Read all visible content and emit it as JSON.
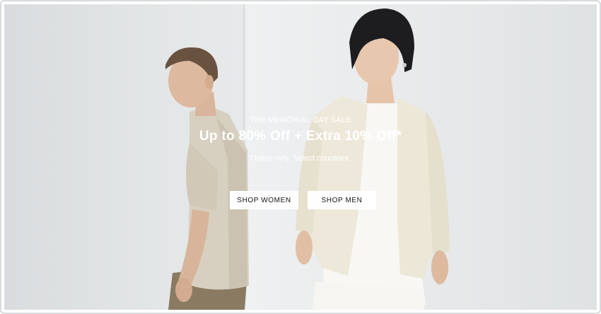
{
  "hero": {
    "kicker": "THE MEMORIAL DAY SALE",
    "headline": "Up to 80% Off + Extra 10% Off*",
    "subline": "Online only. Select countries."
  },
  "actions": {
    "shop_women_label": "SHOP WOMEN",
    "shop_men_label": "SHOP MEN"
  },
  "colors": {
    "wall": "#e8eaeb",
    "text": "#ffffff",
    "button_bg": "#ffffff",
    "button_text": "#111111"
  }
}
